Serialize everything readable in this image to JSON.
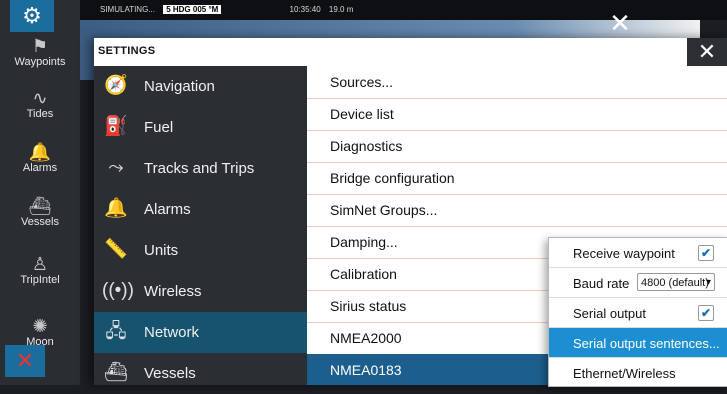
{
  "statusbar": {
    "mode": "SIMULATING...",
    "heading": "5 HDG 005 °M",
    "time": "10:35:40",
    "depth": "19.0 m",
    "close": "✕"
  },
  "rail": {
    "gear": "⚙",
    "items": [
      {
        "label": "Waypoints",
        "icon": "flag-icon"
      },
      {
        "label": "Tides",
        "icon": "tide-wave-icon"
      },
      {
        "label": "Alarms",
        "icon": "bell-icon"
      },
      {
        "label": "Vessels",
        "icon": "vessel-icon"
      },
      {
        "label": "TripIntel",
        "icon": "tripintel-icon"
      },
      {
        "label": "Moon",
        "icon": "moon-icon"
      }
    ],
    "close": "✕"
  },
  "settings": {
    "title": "SETTINGS",
    "close": "✕",
    "categories": [
      {
        "label": "Navigation",
        "icon": "compass-icon"
      },
      {
        "label": "Fuel",
        "icon": "fuel-pump-icon"
      },
      {
        "label": "Tracks and Trips",
        "icon": "tracks-icon"
      },
      {
        "label": "Alarms",
        "icon": "bell-icon"
      },
      {
        "label": "Units",
        "icon": "ruler-icon"
      },
      {
        "label": "Wireless",
        "icon": "wireless-icon"
      },
      {
        "label": "Network",
        "icon": "network-icon"
      },
      {
        "label": "Vessels",
        "icon": "vessel-icon"
      }
    ],
    "selected_category": "Network",
    "options": [
      "Sources...",
      "Device list",
      "Diagnostics",
      "Bridge configuration",
      "SimNet Groups...",
      "Damping...",
      "Calibration",
      "Sirius status",
      "NMEA2000",
      "NMEA0183"
    ],
    "selected_option": "NMEA0183"
  },
  "nmea0183_menu": {
    "receive_waypoint": {
      "label": "Receive waypoint",
      "checked": true
    },
    "baud_rate": {
      "label": "Baud rate",
      "value": "4800 (default)"
    },
    "serial_output": {
      "label": "Serial output",
      "checked": true
    },
    "serial_output_sentences": {
      "label": "Serial output sentences..."
    },
    "ethernet_wireless": {
      "label": "Ethernet/Wireless"
    }
  },
  "colors": {
    "accent": "#1c5f8e",
    "highlight": "#1c8fd2",
    "rail": "#2a2e33"
  }
}
